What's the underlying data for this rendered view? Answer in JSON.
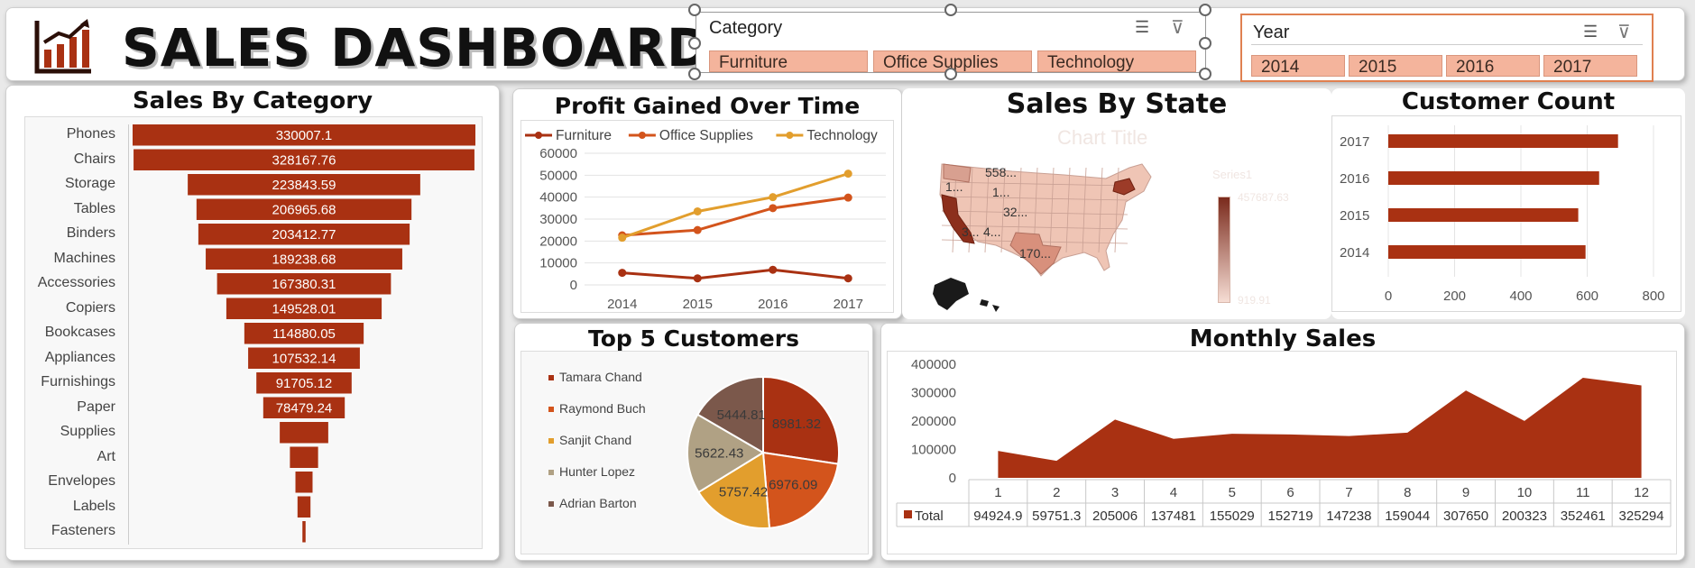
{
  "header": {
    "title": "SALES DASHBOARD",
    "logo_icon": "bar-chart-icon",
    "category_slicer": {
      "label": "Category",
      "options": [
        "Furniture",
        "Office Supplies",
        "Technology"
      ]
    },
    "year_slicer": {
      "label": "Year",
      "options": [
        "2014",
        "2015",
        "2016",
        "2017"
      ]
    }
  },
  "colors": {
    "primary": "#a93112",
    "office": "#d3541c",
    "tech": "#e29e2d",
    "accent": "#f4b49c"
  },
  "panels": {
    "category": "Sales By Category",
    "profit": "Profit Gained Over Time",
    "state": "Sales By State",
    "customers_count": "Customer Count",
    "top5": "Top 5 Customers",
    "monthly": "Monthly Sales"
  },
  "map": {
    "ghost_title": "Chart Title",
    "ghost_series": "Series1",
    "ghost_max": "457687.63",
    "ghost_min": "919.91",
    "labels": [
      "558...",
      "1...",
      "1...",
      "32...",
      "3...",
      "4...",
      "170..."
    ]
  },
  "chart_data": [
    {
      "type": "bar",
      "title": "Sales By Category",
      "orientation": "funnel",
      "categories": [
        "Phones",
        "Chairs",
        "Storage",
        "Tables",
        "Binders",
        "Machines",
        "Accessories",
        "Copiers",
        "Bookcases",
        "Appliances",
        "Furnishings",
        "Paper",
        "Supplies",
        "Art",
        "Envelopes",
        "Labels",
        "Fasteners"
      ],
      "values": [
        330007.1,
        328167.76,
        223843.59,
        206965.68,
        203412.77,
        189238.68,
        167380.31,
        149528.01,
        114880.05,
        107532.14,
        91705.12,
        78479.24,
        46673.54,
        27118.79,
        16476.4,
        12486.31,
        3024.28
      ],
      "labels": [
        "330007.1",
        "328167.76",
        "223843.59",
        "206965.68",
        "203412.77",
        "189238.68",
        "167380.31",
        "149528.01",
        "114880.05",
        "107532.14",
        "91705.12",
        "78479.24",
        "",
        "",
        "",
        "",
        ""
      ]
    },
    {
      "type": "line",
      "title": "Profit Gained Over Time",
      "x": [
        "2014",
        "2015",
        "2016",
        "2017"
      ],
      "series": [
        {
          "name": "Furniture",
          "values": [
            5500,
            3000,
            6900,
            3000
          ]
        },
        {
          "name": "Office Supplies",
          "values": [
            22600,
            25000,
            35000,
            39800
          ]
        },
        {
          "name": "Technology",
          "values": [
            21500,
            33500,
            40000,
            50700
          ]
        }
      ],
      "ylim": [
        0,
        60000
      ],
      "yticks": [
        "0",
        "10000",
        "20000",
        "30000",
        "40000",
        "50000",
        "60000"
      ],
      "legend": "top"
    },
    {
      "type": "bar",
      "title": "Customer Count",
      "orientation": "horizontal",
      "categories": [
        "2017",
        "2016",
        "2015",
        "2014"
      ],
      "values": [
        693,
        636,
        573,
        595
      ],
      "xlim": [
        0,
        800
      ],
      "xticks": [
        "0",
        "200",
        "400",
        "600",
        "800"
      ]
    },
    {
      "type": "pie",
      "title": "Top 5 Customers",
      "categories": [
        "Tamara Chand",
        "Raymond Buch",
        "Sanjit Chand",
        "Hunter Lopez",
        "Adrian Barton"
      ],
      "values": [
        8981.32,
        6976.09,
        5757.42,
        5622.43,
        5444.81
      ],
      "labels": [
        "8981.32",
        "6976.09",
        "5757.42",
        "5622.43",
        "5444.81"
      ],
      "legend": "left"
    },
    {
      "type": "area",
      "title": "Monthly Sales",
      "categories": [
        "1",
        "2",
        "3",
        "4",
        "5",
        "6",
        "7",
        "8",
        "9",
        "10",
        "11",
        "12"
      ],
      "series": [
        {
          "name": "Total",
          "values": [
            94924.9,
            59751.3,
            205006,
            137481,
            155029,
            152719,
            147238,
            159044,
            307650,
            200323,
            352461,
            325294
          ]
        }
      ],
      "table_values": [
        "94924.9",
        "59751.3",
        "205006",
        "137481",
        "155029",
        "152719",
        "147238",
        "159044",
        "307650",
        "200323",
        "352461",
        "325294"
      ],
      "ylim": [
        0,
        400000
      ],
      "yticks": [
        "0",
        "100000",
        "200000",
        "300000",
        "400000"
      ]
    }
  ]
}
